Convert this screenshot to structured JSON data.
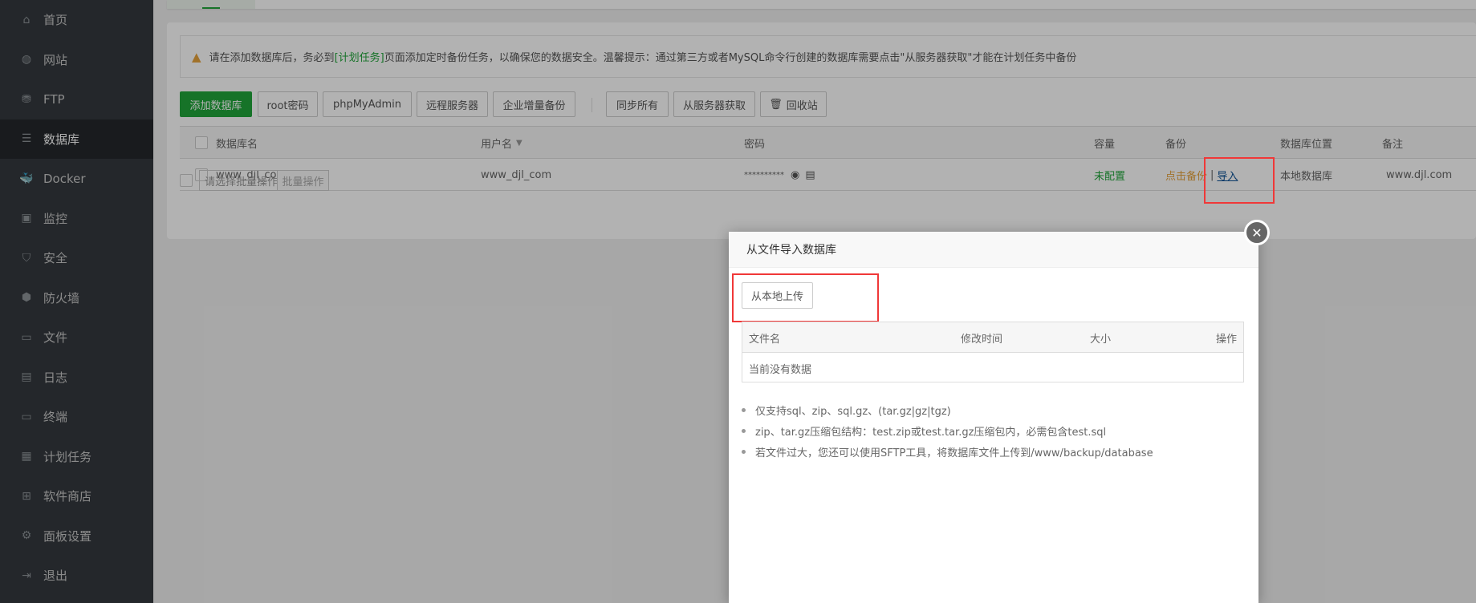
{
  "sidebar": {
    "items": [
      {
        "label": "首页",
        "icon": "home-icon"
      },
      {
        "label": "网站",
        "icon": "globe-icon"
      },
      {
        "label": "FTP",
        "icon": "ftp-icon"
      },
      {
        "label": "数据库",
        "icon": "database-icon",
        "active": true
      },
      {
        "label": "Docker",
        "icon": "docker-icon"
      },
      {
        "label": "监控",
        "icon": "monitor-icon"
      },
      {
        "label": "安全",
        "icon": "shield-icon"
      },
      {
        "label": "防火墙",
        "icon": "firewall-icon"
      },
      {
        "label": "文件",
        "icon": "folder-icon"
      },
      {
        "label": "日志",
        "icon": "log-icon"
      },
      {
        "label": "终端",
        "icon": "terminal-icon"
      },
      {
        "label": "计划任务",
        "icon": "calendar-icon"
      },
      {
        "label": "软件商店",
        "icon": "apps-icon"
      },
      {
        "label": "面板设置",
        "icon": "gear-icon"
      },
      {
        "label": "退出",
        "icon": "logout-icon"
      }
    ]
  },
  "alert": {
    "pre": "请在添加数据库后，务必到",
    "link": "[计划任务]",
    "post": "页面添加定时备份任务，以确保您的数据安全。温馨提示：通过第三方或者MySQL命令行创建的数据库需要点击\"从服务器获取\"才能在计划任务中备份"
  },
  "toolbar": {
    "add": "添加数据库",
    "root": "root密码",
    "pma": "phpMyAdmin",
    "remote": "远程服务器",
    "incr": "企业增量备份",
    "sync": "同步所有",
    "fetch": "从服务器获取",
    "recycle": "回收站"
  },
  "table": {
    "headers": {
      "name": "数据库名",
      "user": "用户名",
      "password": "密码",
      "capacity": "容量",
      "backup": "备份",
      "location": "数据库位置",
      "note": "备注"
    },
    "rows": [
      {
        "name": "www_djl_com",
        "user": "www_djl_com",
        "password": "**********",
        "capacity": "未配置",
        "backup": "点击备份",
        "sep": "|",
        "import": "导入",
        "location": "本地数据库",
        "note": "www.djl.com"
      }
    ]
  },
  "batch": {
    "placeholder": "请选择批量操作",
    "button": "批量操作"
  },
  "modal": {
    "title": "从文件导入数据库",
    "upload": "从本地上传",
    "headers": {
      "file": "文件名",
      "mtime": "修改时间",
      "size": "大小",
      "op": "操作"
    },
    "empty": "当前没有数据",
    "tips": [
      "仅支持sql、zip、sql.gz、(tar.gz|gz|tgz)",
      "zip、tar.gz压缩包结构：test.zip或test.tar.gz压缩包内，必需包含test.sql",
      "若文件过大，您还可以使用SFTP工具，将数据库文件上传到/www/backup/database"
    ],
    "close": "✕"
  },
  "colors": {
    "accent": "#20a53a",
    "warning": "#e6a23c",
    "highlight": "#f03838",
    "link": "#0b4f94"
  }
}
